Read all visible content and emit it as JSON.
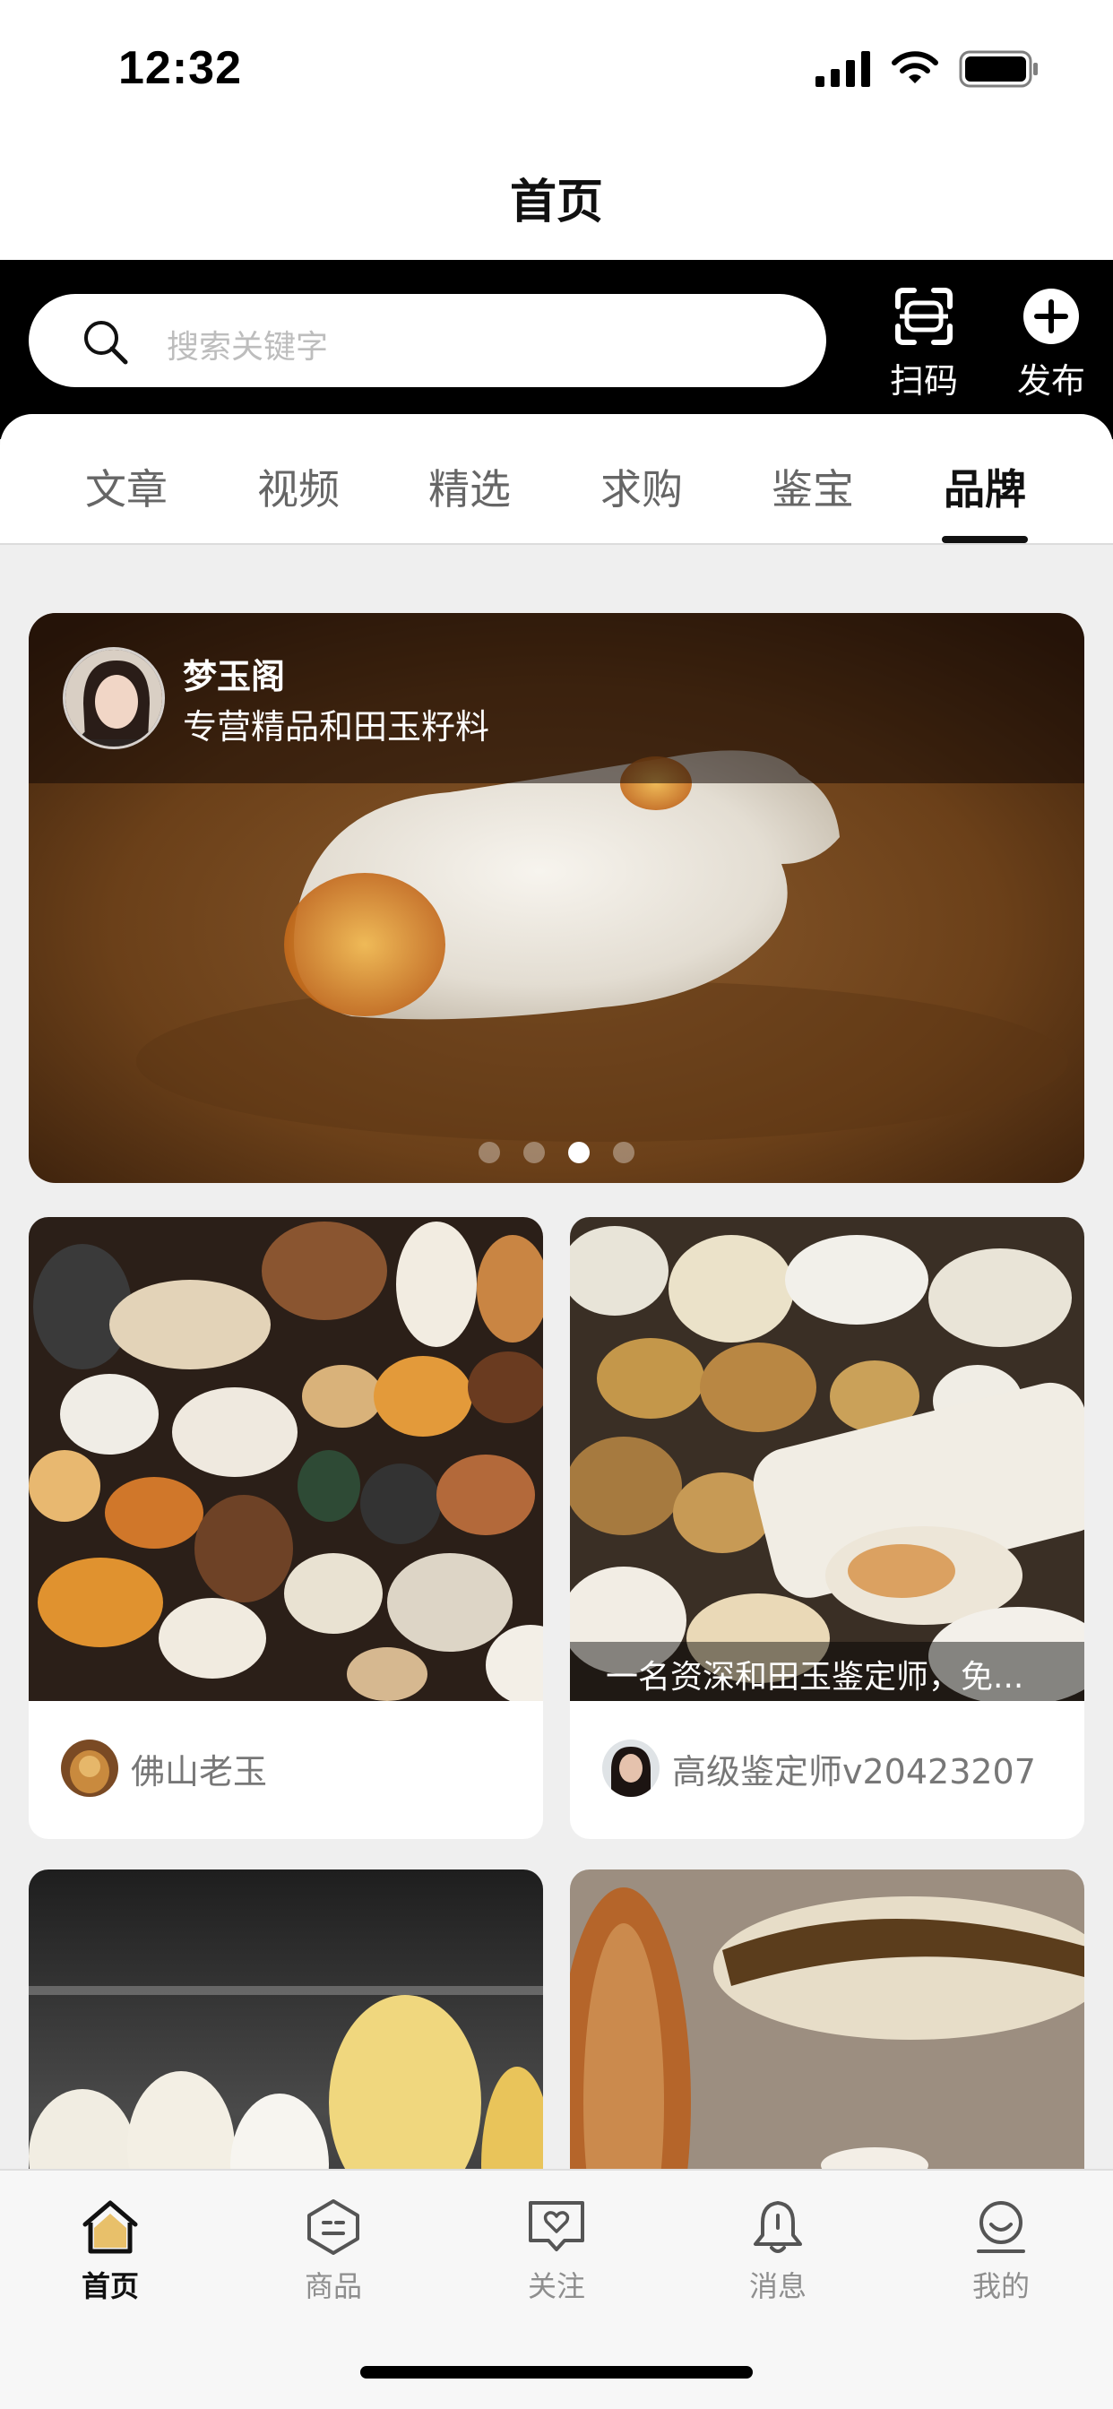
{
  "status": {
    "time": "12:32"
  },
  "header": {
    "title": "首页"
  },
  "search": {
    "placeholder": "搜索关键字"
  },
  "actions": [
    {
      "label": "扫码",
      "icon": "scan-icon"
    },
    {
      "label": "发布",
      "icon": "plus-circle-icon"
    }
  ],
  "tabs": [
    {
      "label": "文章"
    },
    {
      "label": "视频"
    },
    {
      "label": "精选"
    },
    {
      "label": "求购"
    },
    {
      "label": "鉴宝"
    },
    {
      "label": "品牌",
      "active": true
    }
  ],
  "banner": {
    "name": "梦玉阁",
    "description": "专营精品和田玉籽料",
    "slide_count": 4,
    "active_slide": 3
  },
  "cards": [
    {
      "author": "佛山老玉",
      "caption": ""
    },
    {
      "author": "高级鉴定师v20423207",
      "caption": "一名资深和田玉鉴定师，免..."
    },
    {
      "author": "",
      "caption": ""
    },
    {
      "author": "",
      "caption": ""
    }
  ],
  "tabbar": [
    {
      "label": "首页",
      "icon": "home-icon",
      "active": true
    },
    {
      "label": "商品",
      "icon": "product-icon"
    },
    {
      "label": "关注",
      "icon": "follow-icon"
    },
    {
      "label": "消息",
      "icon": "bell-icon"
    },
    {
      "label": "我的",
      "icon": "profile-icon"
    }
  ],
  "colors": {
    "accent": "#111111",
    "header_bar": "#000000",
    "inactive": "#8e8e8e"
  }
}
